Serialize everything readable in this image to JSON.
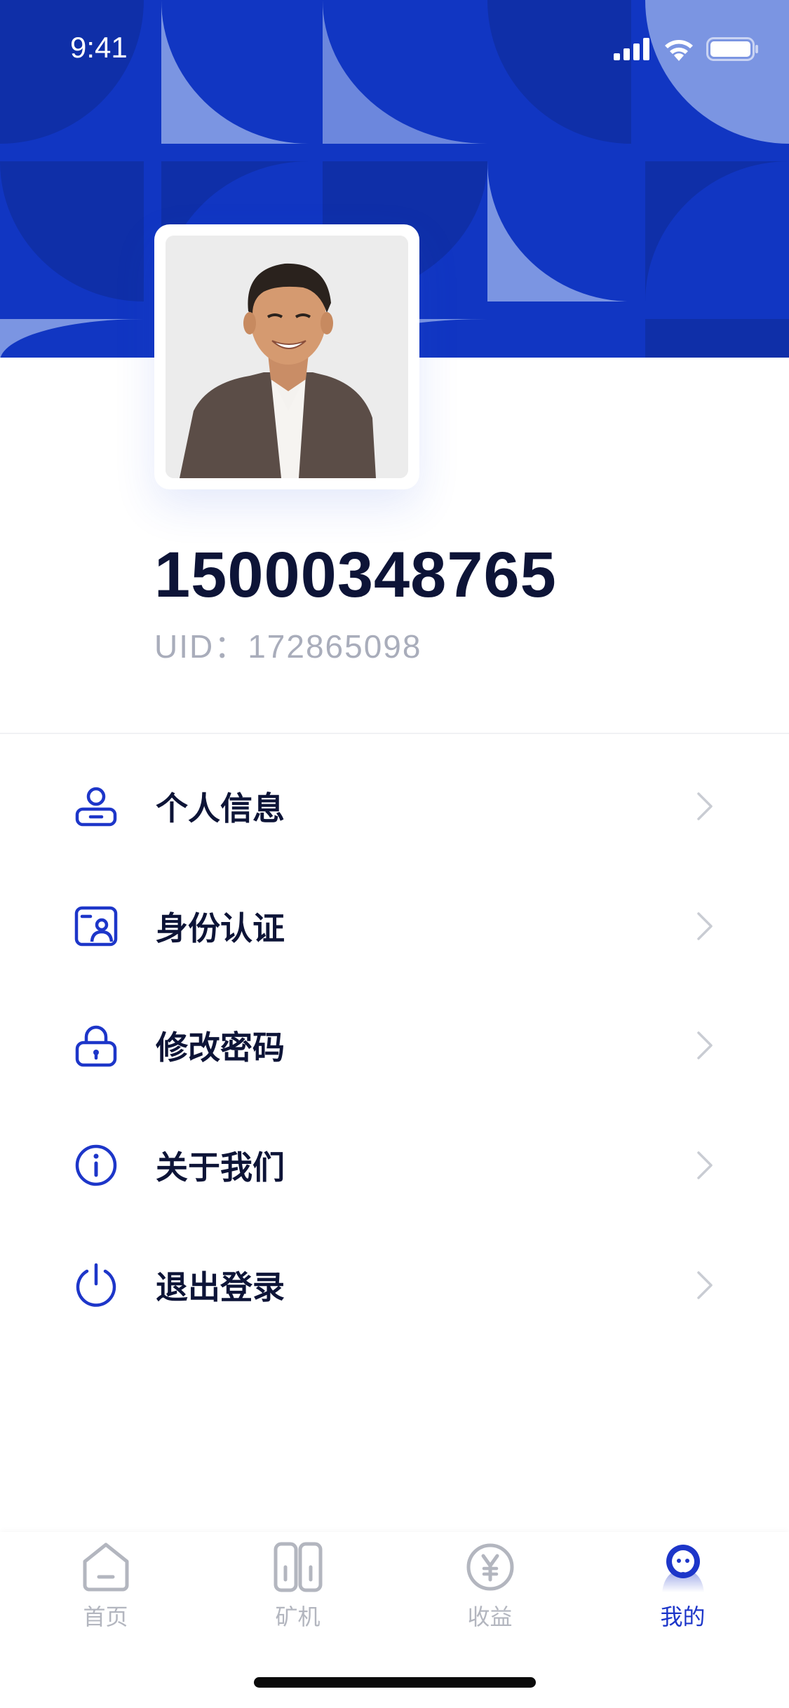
{
  "status_bar": {
    "time": "9:41",
    "icons": [
      "signal-icon",
      "wifi-icon",
      "battery-icon"
    ]
  },
  "profile": {
    "phone": "15000348765",
    "uid_text": "UID：172865098"
  },
  "menu": {
    "items": [
      {
        "icon": "user-icon",
        "label": "个人信息"
      },
      {
        "icon": "id-card-icon",
        "label": "身份认证"
      },
      {
        "icon": "lock-icon",
        "label": "修改密码"
      },
      {
        "icon": "info-icon",
        "label": "关于我们"
      },
      {
        "icon": "power-icon",
        "label": "退出登录"
      }
    ]
  },
  "tabbar": {
    "tabs": [
      {
        "icon": "home-icon",
        "label": "首页",
        "active": false
      },
      {
        "icon": "miner-icon",
        "label": "矿机",
        "active": false
      },
      {
        "icon": "yen-coin-icon",
        "label": "收益",
        "active": false
      },
      {
        "icon": "profile-icon",
        "label": "我的",
        "active": true
      }
    ]
  },
  "colors": {
    "brand_blue": "#1136c2",
    "accent_blue": "#1d36c9",
    "text_dark": "#0d1437",
    "text_muted": "#a9adbb",
    "tab_inactive": "#b3b6bf"
  }
}
